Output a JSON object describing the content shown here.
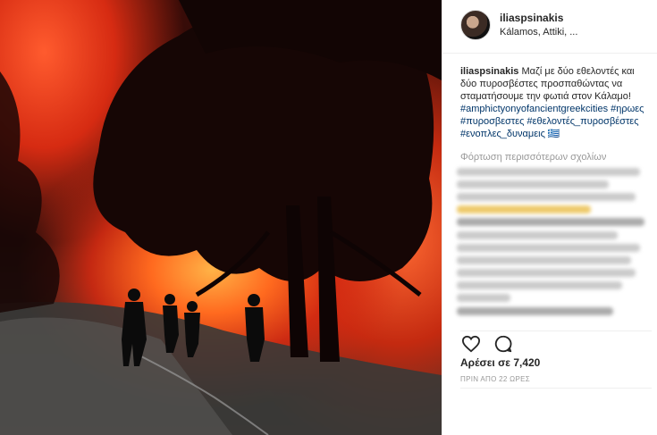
{
  "post": {
    "username": "iliaspsinakis",
    "location": "Kálamos, Attiki, ...",
    "caption_username": "iliaspsinakis",
    "caption_text": " Μαζί με δύο εθελοντές και δύο πυροσβέστες προσπαθώντας να σταματήσουμε την φωτιά στον Κάλαμο! ",
    "hashtags": "#amphictyonyofancientgreekcities #ηρωες #πυροσβεστες #εθελοντές_πυροσβέστες #ενοπλες_δυναμεις 🇬🇷",
    "load_more": "Φόρτωση περισσότερων σχολίων",
    "likes": "Αρέσει σε 7,420",
    "time_ago": "ΠΡΙΝ ΑΠΟ 22 ΩΡΕΣ"
  },
  "icons": {
    "like": "heart-icon",
    "comment": "comment-icon"
  },
  "colors": {
    "link": "#003569",
    "text": "#262626",
    "muted": "#999999"
  }
}
